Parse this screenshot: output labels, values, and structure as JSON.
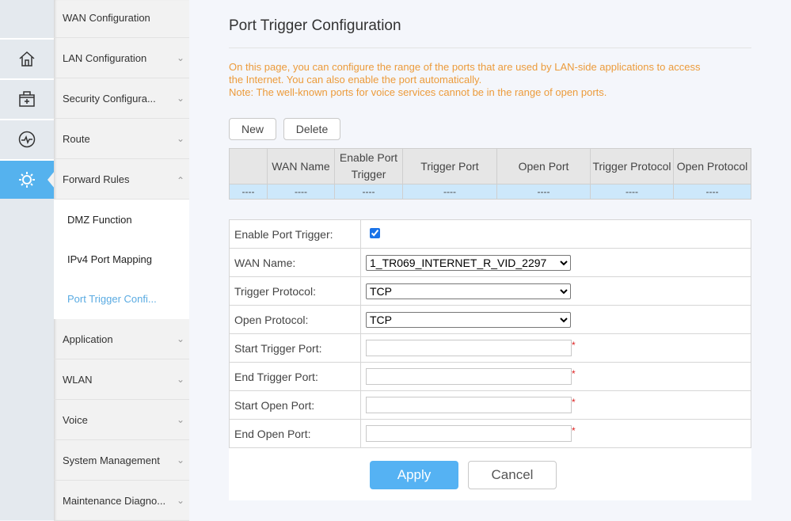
{
  "rail": [
    {
      "icon": "home-icon"
    },
    {
      "icon": "medkit-icon"
    },
    {
      "icon": "pulse-icon"
    },
    {
      "icon": "gear-icon",
      "active": true
    }
  ],
  "menu": {
    "items": [
      "WAN Configuration",
      "LAN Configuration",
      "Security Configura...",
      "Route",
      "Forward Rules",
      "Application",
      "WLAN",
      "Voice",
      "System Management",
      "Maintenance Diagno..."
    ],
    "sub": [
      "DMZ Function",
      "IPv4 Port Mapping",
      "Port Trigger Confi..."
    ]
  },
  "page": {
    "title": "Port Trigger Configuration",
    "notes": [
      "On this page, you can configure the range of the ports that are used by LAN-side applications to access",
      "the Internet. You can also enable the port automatically.",
      "Note: The well-known ports for voice services cannot be in the range of open ports."
    ],
    "new_label": "New",
    "delete_label": "Delete"
  },
  "table": {
    "headers": [
      "",
      "WAN Name",
      "Enable Port Trigger",
      "Trigger Port",
      "Open Port",
      "Trigger Protocol",
      "Open Protocol"
    ],
    "row": [
      "----",
      "----",
      "----",
      "----",
      "----",
      "----",
      "----"
    ]
  },
  "form": {
    "enable_label": "Enable Port Trigger:",
    "enable_checked": true,
    "wan_label": "WAN Name:",
    "wan_value": "1_TR069_INTERNET_R_VID_2297",
    "trigger_proto_label": "Trigger Protocol:",
    "trigger_proto_value": "TCP",
    "open_proto_label": "Open Protocol:",
    "open_proto_value": "TCP",
    "fields": [
      "Start Trigger Port:",
      "End Trigger Port:",
      "Start Open Port:",
      "End Open Port:"
    ],
    "required_mark": "*"
  },
  "actions": {
    "apply": "Apply",
    "cancel": "Cancel"
  },
  "colors": {
    "accent": "#55b2ee",
    "note": "#ec9b3b"
  }
}
